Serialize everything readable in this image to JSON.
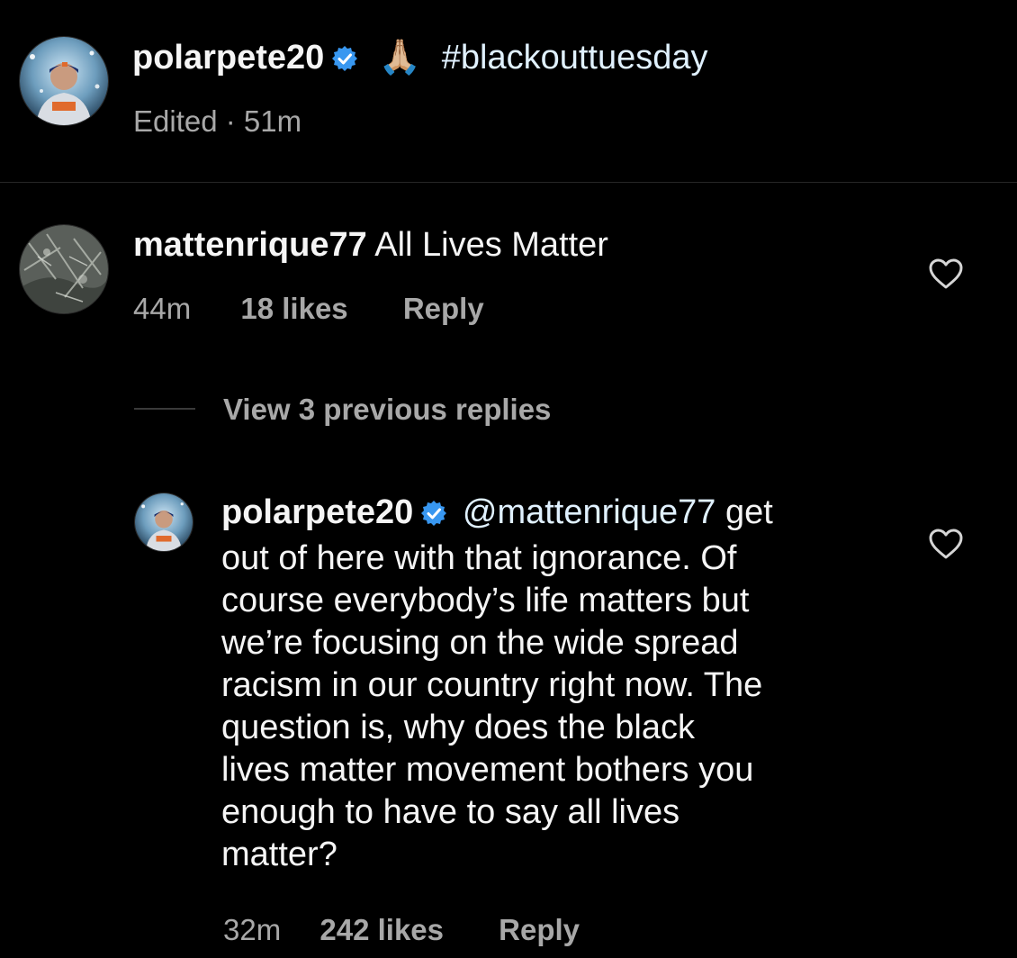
{
  "post": {
    "username": "polarpete20",
    "emoji": "🙏🏼",
    "caption": "#blackouttuesday",
    "edited_label": "Edited",
    "separator": "·",
    "time": "51m"
  },
  "comment": {
    "username": "mattenrique77",
    "text": "All Lives Matter",
    "time": "44m",
    "likes": "18 likes",
    "reply_label": "Reply"
  },
  "view_replies_label": "View 3 previous replies",
  "reply": {
    "username": "polarpete20",
    "mention": "@mattenrique77",
    "lines": [
      "get",
      "out of here with that ignorance. Of",
      "course everybody’s life matters but",
      "we’re focusing on the wide spread",
      "racism in our country right now. The",
      "question is, why does the black",
      "lives matter movement bothers you",
      "enough to have to say all lives",
      "matter?"
    ],
    "time": "32m",
    "likes": "242 likes",
    "reply_label": "Reply"
  },
  "icons": {
    "verified": "verified-badge-icon",
    "like": "heart-outline-icon"
  },
  "colors": {
    "background": "#000000",
    "text": "#f5f5f5",
    "secondary": "#a8a8a8",
    "link": "#e0f1ff",
    "verified": "#3897f0"
  }
}
